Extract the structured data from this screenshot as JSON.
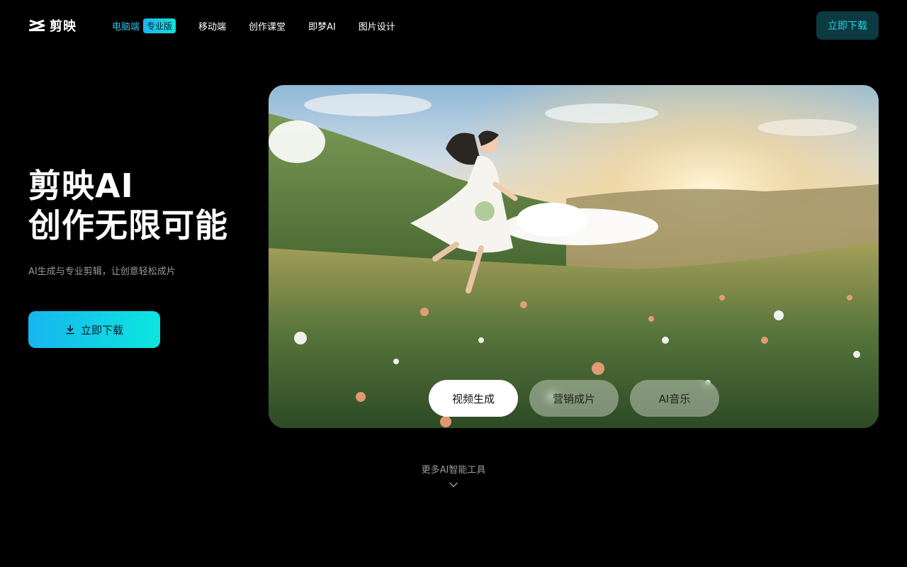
{
  "brand": {
    "name": "剪映",
    "logo_icon": "capcut-logo-icon"
  },
  "nav": {
    "items": [
      {
        "label": "电脑端",
        "badge": "专业版",
        "active": true
      },
      {
        "label": "移动端"
      },
      {
        "label": "创作课堂"
      },
      {
        "label": "即梦AI"
      },
      {
        "label": "图片设计"
      }
    ]
  },
  "header": {
    "download_label": "立即下载"
  },
  "hero": {
    "title_line1": "剪映AI",
    "title_line2": "创作无限可能",
    "subtitle": "AI生成与专业剪辑，让创意轻松成片",
    "download_label": "立即下载",
    "download_icon": "download-icon"
  },
  "media": {
    "tabs": [
      {
        "label": "视频生成",
        "active": true
      },
      {
        "label": "营销成片"
      },
      {
        "label": "AI音乐"
      }
    ]
  },
  "more_tools": {
    "label": "更多AI智能工具",
    "icon": "chevron-down-icon"
  },
  "colors": {
    "accent": "#2fc0e8",
    "cta_start": "#17b6ee",
    "cta_end": "#0ce6df",
    "background": "#000000"
  }
}
